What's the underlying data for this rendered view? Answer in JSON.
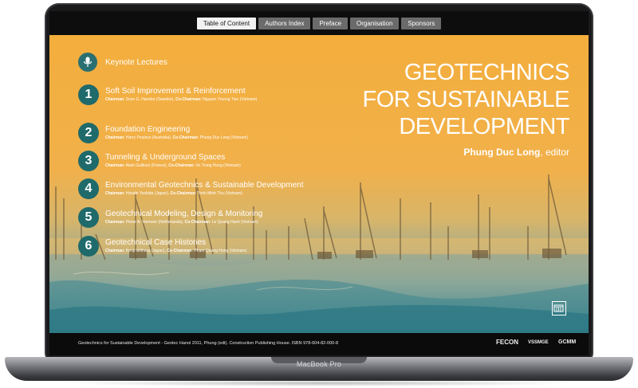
{
  "device": {
    "model_label": "MacBook Pro"
  },
  "nav": {
    "tabs": [
      {
        "label": "Table of Content",
        "active": true
      },
      {
        "label": "Authors Index",
        "active": false
      },
      {
        "label": "Preface",
        "active": false
      },
      {
        "label": "Organisation",
        "active": false
      },
      {
        "label": "Sponsors",
        "active": false
      }
    ]
  },
  "keynote": {
    "label": "Keynote Lectures",
    "icon": "microphone-icon"
  },
  "topics": [
    {
      "num": "1",
      "title": "Soft Soil Improvement & Reinforcement",
      "chair_label": "Chairman",
      "chair": "Sven G. Hansbo (Sweden)",
      "cochair_label": "Co-Chairman",
      "cochair": "Nguyen Truong Tien (Vietnam)"
    },
    {
      "num": "2",
      "title": "Foundation Engineering",
      "chair_label": "Chairman",
      "chair": "Harry Poulous (Australia)",
      "cochair_label": "Co-Chairman",
      "cochair": "Phung Duc Long (Vietnam)"
    },
    {
      "num": "3",
      "title": "Tunneling & Underground Spaces",
      "chair_label": "Chairman",
      "chair": "Alain Guilloux (France)",
      "cochair_label": "Co-Chairman",
      "cochair": "Vo Trong Hung (Vietnam)"
    },
    {
      "num": "4",
      "title": "Environmental Geotechnics & Sustainable Development",
      "chair_label": "Chairman",
      "chair": "Hiroshi Yoshida (Japan)",
      "cochair_label": "Co-Chairman",
      "cochair": "Trinh Minh Thu (Vietnam)"
    },
    {
      "num": "5",
      "title": "Geotechnical Modeling, Design & Monitoring",
      "chair_label": "Chairman",
      "chair": "Pieter A. Vermeer (Netherlands)",
      "cochair_label": "Co-Chairman",
      "cochair": "Le Quang Hanh (Vietnam)"
    },
    {
      "num": "6",
      "title": "Geotechnical Case Histories",
      "chair_label": "Chairman",
      "chair": "Kenji Ishihara (Japan)",
      "cochair_label": "Co-Chairman",
      "cochair": "Pham Quang Hung (Vietnam)"
    }
  ],
  "book": {
    "title_lines": [
      "GEOTECHNICS",
      "FOR SUSTAINABLE",
      "DEVELOPMENT"
    ],
    "editor_name": "Phung Duc Long",
    "editor_suffix": ", editor"
  },
  "footer": {
    "citation": "Geotechnics for Sustainable Development - Geotec Hanoi 2011, Phung (edt). Construction Publishing House. ISBN 978-604-82-000-8",
    "logos": [
      "FECON",
      "VSSMGE",
      "GCMM"
    ]
  },
  "colors": {
    "accent_teal": "#1f6a6b",
    "hero_orange": "#f3ae3c",
    "nav_active": "#f2f2f2",
    "nav_inactive": "#6b6b6b"
  }
}
